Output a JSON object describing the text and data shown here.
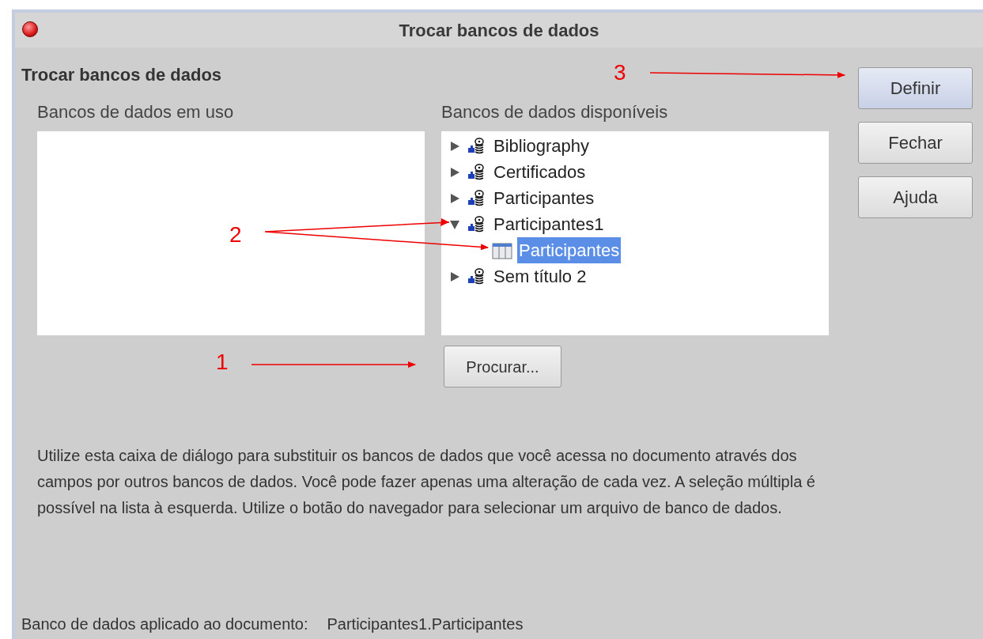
{
  "window": {
    "title": "Trocar bancos de dados"
  },
  "heading": "Trocar bancos de dados",
  "in_use": {
    "label": "Bancos de dados em uso"
  },
  "available": {
    "label": "Bancos de dados disponíveis",
    "items": [
      {
        "kind": "database",
        "label": "Bibliography",
        "expanded": false,
        "selected": false
      },
      {
        "kind": "database",
        "label": "Certificados",
        "expanded": false,
        "selected": false
      },
      {
        "kind": "database",
        "label": "Participantes",
        "expanded": false,
        "selected": false
      },
      {
        "kind": "database",
        "label": "Participantes1",
        "expanded": true,
        "selected": false,
        "children": [
          {
            "kind": "table",
            "label": "Participantes",
            "selected": true
          }
        ]
      },
      {
        "kind": "database",
        "label": "Sem título 2",
        "expanded": false,
        "selected": false
      }
    ]
  },
  "browse_button": "Procurar...",
  "buttons": [
    {
      "label": "Definir",
      "default": true
    },
    {
      "label": "Fechar",
      "default": false
    },
    {
      "label": "Ajuda",
      "default": false
    }
  ],
  "description": "Utilize esta caixa de diálogo para substituir os bancos de dados que você acessa no documento através dos campos por outros bancos de dados. Você pode fazer apenas uma alteração de cada vez. A seleção múltipla é possível na lista à esquerda. Utilize o botão do navegador para selecionar um arquivo de banco de dados.",
  "status": {
    "label": "Banco de dados aplicado ao documento:",
    "value": "Participantes1.Participantes"
  },
  "annotations": [
    {
      "label": "1"
    },
    {
      "label": "2"
    },
    {
      "label": "3"
    }
  ]
}
